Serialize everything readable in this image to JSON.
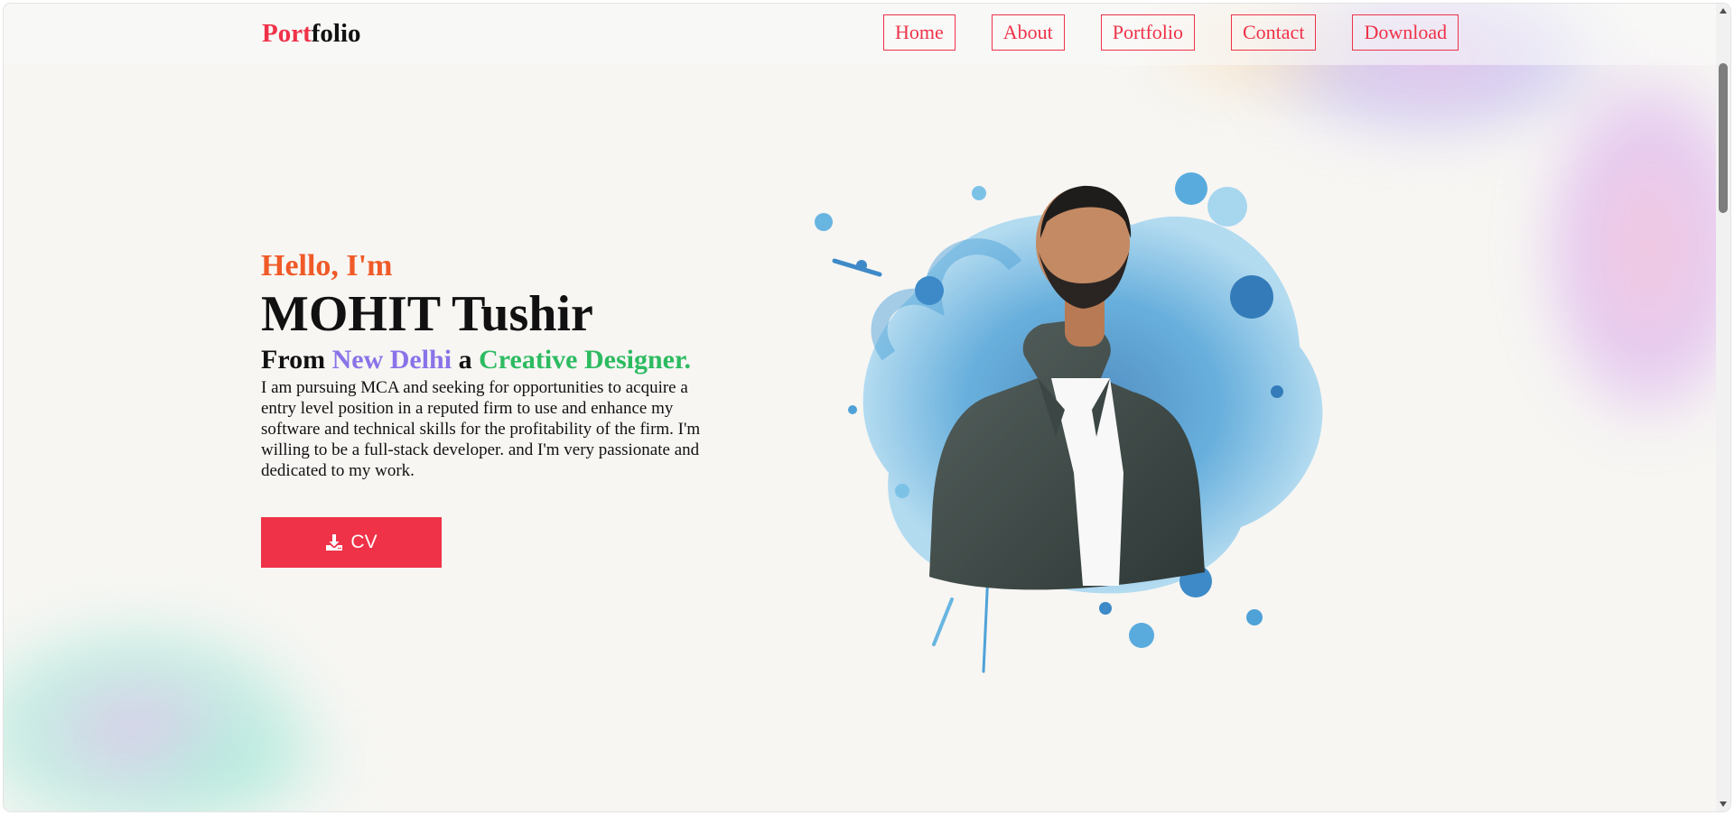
{
  "header": {
    "logo_accent": "Port",
    "logo_rest": "folio",
    "nav": [
      "Home",
      "About",
      "Portfolio",
      "Contact",
      "Download"
    ]
  },
  "hero": {
    "greeting": "Hello, I'm",
    "name": "MOHIT Tushir",
    "from_text": "From ",
    "city": "New Delhi",
    "joiner": " a ",
    "role": "Creative Designer.",
    "description": "I am pursuing MCA and seeking for opportunities to acquire a entry level position in a reputed firm to use and enhance my software and technical skills for the profitability of the firm. I'm willing to be a full-stack developer. and I'm very passionate and dedicated to my work.",
    "cv_label": "CV",
    "cv_icon": "download-icon"
  },
  "colors": {
    "accent": "#ef3248",
    "greeting": "#f05a28",
    "city": "#8a73e8",
    "role": "#2dbb61",
    "background": "#f7f6f3"
  }
}
